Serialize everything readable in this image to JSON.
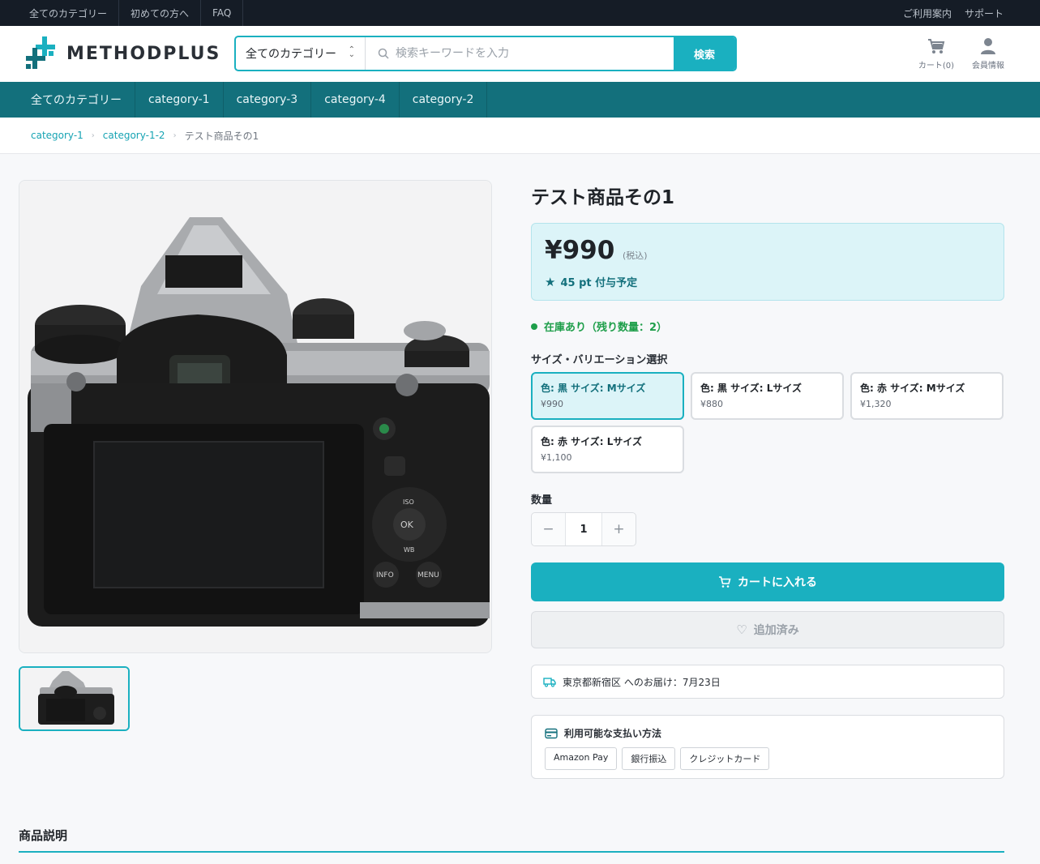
{
  "topbar": {
    "left_links": [
      "全てのカテゴリー",
      "初めての方へ",
      "FAQ"
    ],
    "right_links": [
      "ご利用案内",
      "サポート"
    ]
  },
  "header": {
    "logo_text": "METHODPLUS",
    "search": {
      "category_value": "全てのカテゴリー",
      "placeholder": "検索キーワードを入力",
      "button_label": "検索"
    },
    "cart_label": "カート(0)",
    "member_label": "会員情報"
  },
  "category_nav": [
    "全てのカテゴリー",
    "category-1",
    "category-3",
    "category-4",
    "category-2"
  ],
  "breadcrumb": {
    "items": [
      "category-1",
      "category-1-2"
    ],
    "current": "テスト商品その1"
  },
  "product": {
    "title": "テスト商品その1",
    "price": "¥990",
    "tax_note": "(税込)",
    "points": "45 pt 付与予定",
    "stock": "在庫あり（残り数量：2）",
    "variation_heading": "サイズ・バリエーション選択",
    "variations": [
      {
        "name": "色: 黒 サイズ: Mサイズ",
        "price": "¥990",
        "selected": true
      },
      {
        "name": "色: 黒 サイズ: Lサイズ",
        "price": "¥880",
        "selected": false
      },
      {
        "name": "色: 赤 サイズ: Mサイズ",
        "price": "¥1,320",
        "selected": false
      },
      {
        "name": "色: 赤 サイズ: Lサイズ",
        "price": "¥1,100",
        "selected": false
      }
    ],
    "quantity_label": "数量",
    "quantity": "1",
    "add_to_cart_label": "カートに入れる",
    "wishlist_label": "追加済み",
    "delivery": "東京都新宿区 へのお届け：7月23日",
    "payment_title": "利用可能な支払い方法",
    "payment_methods": [
      "Amazon Pay",
      "銀行振込",
      "クレジットカード"
    ]
  },
  "description_title": "商品説明",
  "colors": {
    "accent": "#1ab0c0",
    "nav_bg": "#13707c",
    "topbar_bg": "#151c26",
    "stock_green": "#1e9e4a",
    "price_bg": "#dcf4f8"
  }
}
